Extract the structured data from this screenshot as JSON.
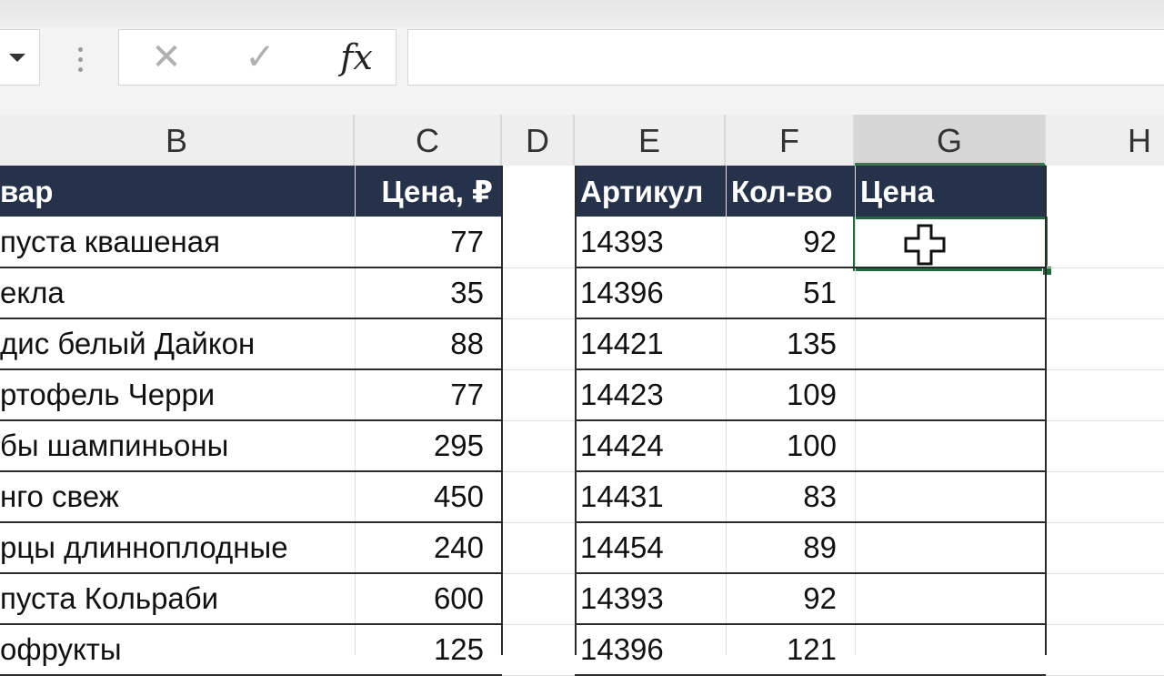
{
  "formula_bar": {
    "cancel_glyph": "✕",
    "enter_glyph": "✓",
    "fx_label": "fx",
    "value": ""
  },
  "columns": [
    "B",
    "C",
    "D",
    "E",
    "F",
    "G",
    "H"
  ],
  "table_left": {
    "headers": {
      "product": "вар",
      "price": "Цена, ₽"
    },
    "rows": [
      {
        "product": "пуста квашеная",
        "price": "77"
      },
      {
        "product": "екла",
        "price": "35"
      },
      {
        "product": "дис белый Дайкон",
        "price": "88"
      },
      {
        "product": "ртофель Черри",
        "price": "77"
      },
      {
        "product": "бы шампиньоны",
        "price": "295"
      },
      {
        "product": "нго свеж",
        "price": "450"
      },
      {
        "product": "рцы длинноплодные",
        "price": "240"
      },
      {
        "product": "пуста Кольраби",
        "price": "600"
      },
      {
        "product": "офрукты",
        "price": "125"
      }
    ]
  },
  "table_right": {
    "headers": {
      "article": "Артикул",
      "qty": "Кол-во",
      "price": "Цена"
    },
    "rows": [
      {
        "article": "14393",
        "qty": "92",
        "price": ""
      },
      {
        "article": "14396",
        "qty": "51",
        "price": ""
      },
      {
        "article": "14421",
        "qty": "135",
        "price": ""
      },
      {
        "article": "14423",
        "qty": "109",
        "price": ""
      },
      {
        "article": "14424",
        "qty": "100",
        "price": ""
      },
      {
        "article": "14431",
        "qty": "83",
        "price": ""
      },
      {
        "article": "14454",
        "qty": "89",
        "price": ""
      },
      {
        "article": "14393",
        "qty": "92",
        "price": ""
      },
      {
        "article": "14396",
        "qty": "121",
        "price": ""
      }
    ]
  },
  "active_cell": "G3",
  "icons": {
    "cursor": "plus-cursor-icon",
    "dropdown": "chevron-down-icon"
  },
  "colors": {
    "header_bg": "#25324a",
    "selection": "#1f6b3f"
  }
}
